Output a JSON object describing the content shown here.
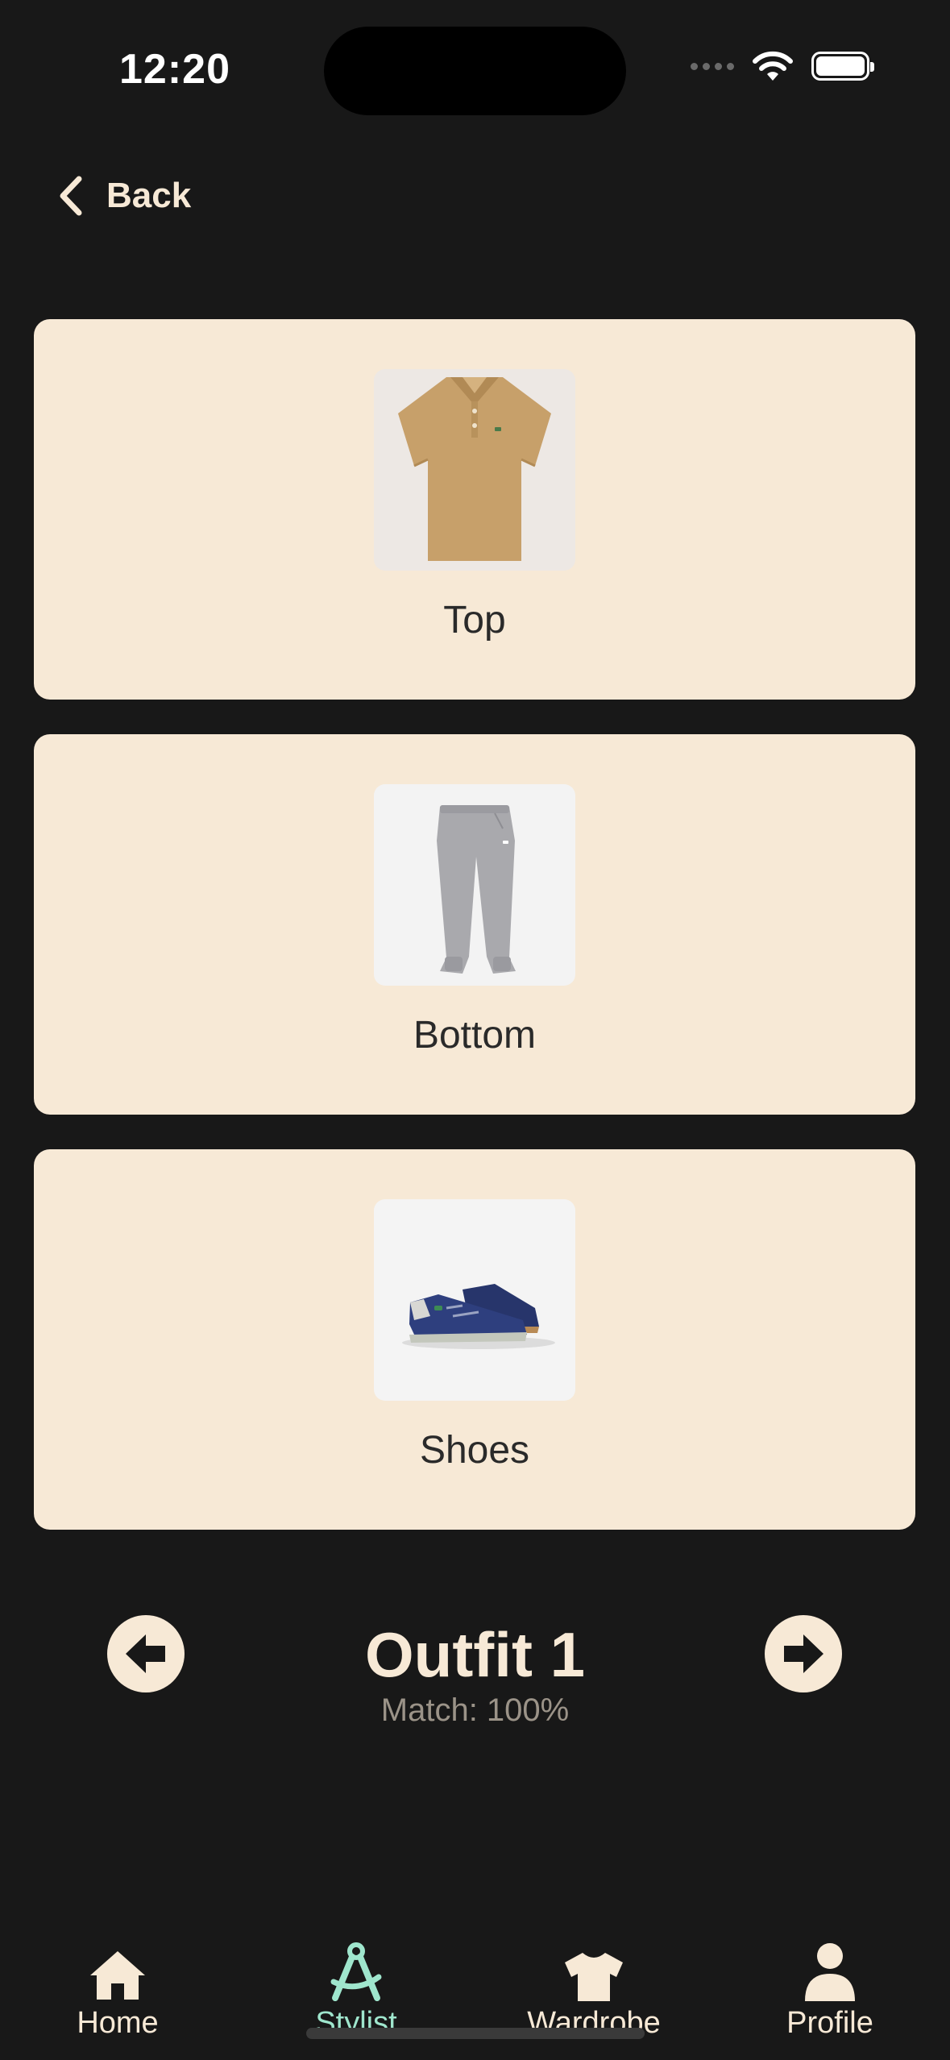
{
  "status_bar": {
    "time": "12:20"
  },
  "header": {
    "back_label": "Back"
  },
  "cards": {
    "top": {
      "label": "Top",
      "image": "tan-polo-shirt"
    },
    "bottom": {
      "label": "Bottom",
      "image": "grey-jogger-pants"
    },
    "shoes": {
      "label": "Shoes",
      "image": "navy-sneakers"
    }
  },
  "outfit": {
    "title": "Outfit 1",
    "match": "Match: 100%"
  },
  "tabs": [
    {
      "label": "Home",
      "icon": "home-icon"
    },
    {
      "label": "Stylist",
      "icon": "compass-icon",
      "active": true
    },
    {
      "label": "Wardrobe",
      "icon": "tshirt-icon"
    },
    {
      "label": "Profile",
      "icon": "person-icon"
    }
  ],
  "colors": {
    "background": "#181818",
    "card": "#f7e9d6",
    "accent": "#9fe6cd",
    "muted": "#9b9388"
  }
}
